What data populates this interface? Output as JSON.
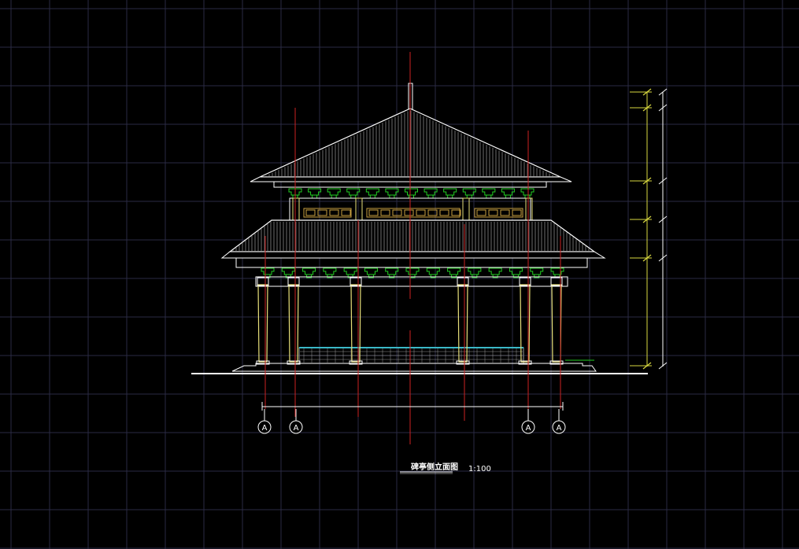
{
  "drawing": {
    "title": "碑亭侧立面图",
    "scale": "1:100",
    "axis_markers": [
      "A",
      "A",
      "A",
      "A"
    ]
  },
  "colors": {
    "background": "#000000",
    "grid": "#2a2a44",
    "outline": "#ffffff",
    "roof_fill": "#8a8a8a",
    "bracket": "#22cc22",
    "column": "#e8e07a",
    "lattice": "#c8a040",
    "axis_line": "#cc2222",
    "dimension": "#d8d840",
    "base_wall": "#9a9a9a",
    "water_line": "#3ab8c8"
  }
}
